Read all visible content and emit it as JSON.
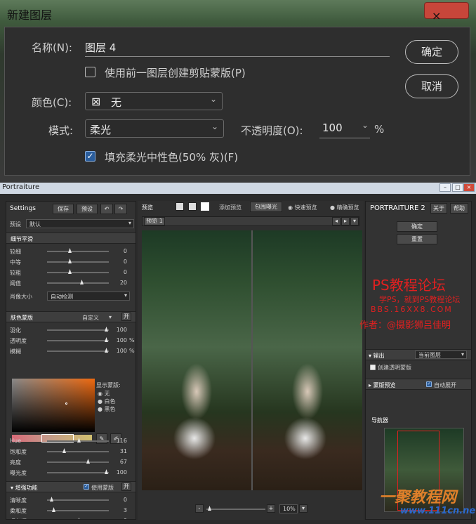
{
  "dialog": {
    "title": "新建图层",
    "close_icon": "×",
    "name_label": "名称(N):",
    "name_value": "图层 4",
    "clip_label": "使用前一图层创建剪贴蒙版(P)",
    "color_label": "颜色(C):",
    "color_value": "无",
    "color_icon": "⊠",
    "mode_label": "模式:",
    "mode_value": "柔光",
    "opacity_label": "不透明度(O):",
    "opacity_value": "100",
    "opacity_unit": "%",
    "fill_label": "填充柔光中性色(50% 灰)(F)",
    "ok": "确定",
    "cancel": "取消"
  },
  "portraiture": {
    "title": "Portraiture",
    "left": {
      "settings": "Settings",
      "save": "保存",
      "preset": "预设",
      "preset_label": "预设",
      "preset_value": "默认",
      "detail_section": "细节平滑",
      "detail": [
        {
          "label": "较细",
          "value": "0",
          "pos": 0.35
        },
        {
          "label": "中等",
          "value": "0",
          "pos": 0.35
        },
        {
          "label": "较粗",
          "value": "0",
          "pos": 0.35
        },
        {
          "label": "阈值",
          "value": "20",
          "pos": 0.55
        }
      ],
      "portrait_size_label": "肖像大小",
      "portrait_size_value": "自动检测",
      "skin_section": "肤色蒙版",
      "skin_custom": "自定义",
      "skin_toggle": "开",
      "skin": [
        {
          "label": "羽化",
          "value": "100",
          "unit": "",
          "pos": 0.95
        },
        {
          "label": "透明度",
          "value": "100",
          "unit": "%",
          "pos": 0.95
        },
        {
          "label": "模糊",
          "value": "100",
          "unit": "%",
          "pos": 0.95
        }
      ],
      "show_mask": "显示蒙版:",
      "mask_opts": [
        "无",
        "白色",
        "黑色"
      ],
      "hsl": [
        {
          "label": "Hue",
          "value": "116",
          "pos": 0.5
        },
        {
          "label": "饱和度",
          "value": "31",
          "pos": 0.25
        },
        {
          "label": "亮度",
          "value": "67",
          "pos": 0.65
        },
        {
          "label": "曝光度",
          "value": "100",
          "pos": 0.95
        }
      ],
      "enh_section": "增强功能",
      "use_mask": "使用蒙版",
      "enh_toggle": "开",
      "enh": [
        {
          "label": "清晰度",
          "value": "0",
          "pos": 0.05
        },
        {
          "label": "柔和度",
          "value": "3",
          "pos": 0.08
        },
        {
          "label": "暖色调",
          "value": "0",
          "pos": 0.5
        },
        {
          "label": "色调",
          "value": "0",
          "pos": 0.5
        }
      ]
    },
    "mid": {
      "preview": "预览",
      "add_preview": "添加预览",
      "exposure": "包围曝光",
      "fast": "快速预览",
      "accurate": "精确预览",
      "tab": "预览 1",
      "zoom": "10%",
      "minus": "-",
      "plus": "+"
    },
    "right": {
      "brand": "PORTRAITURE 2",
      "about": "关于",
      "help": "帮助",
      "ok": "确定",
      "reset": "重置",
      "output": "输出",
      "output_value": "当前图层",
      "create_transparent": "创建透明蒙版",
      "mask_preview": "蒙版预览",
      "auto_expand": "自动展开",
      "navigator": "导航器"
    }
  },
  "watermarks": {
    "w1": "PS教程论坛",
    "w2": "学PS，就到PS教程论坛",
    "w3": "BBS.16XX8.COM",
    "w4": "作者：@摄影狮吕佳明",
    "w5": "一聚教程网",
    "w6": "www.111cn.net"
  }
}
